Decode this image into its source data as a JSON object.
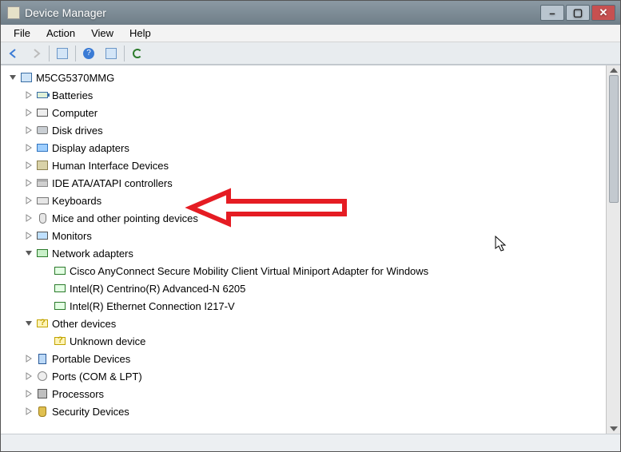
{
  "title": "Device Manager",
  "menu": {
    "file": "File",
    "action": "Action",
    "view": "View",
    "help": "Help"
  },
  "window_controls": {
    "min": "–",
    "max": "▢",
    "close": "✕"
  },
  "toolbar": {
    "back": "back",
    "fwd": "forward",
    "show": "show/hide console tree",
    "help": "?",
    "prop": "properties",
    "scan": "scan"
  },
  "tree": {
    "root": "M5CG5370MMG",
    "items": [
      {
        "label": "Batteries",
        "expanded": false,
        "icon": "battery"
      },
      {
        "label": "Computer",
        "expanded": false,
        "icon": "computer"
      },
      {
        "label": "Disk drives",
        "expanded": false,
        "icon": "drive"
      },
      {
        "label": "Display adapters",
        "expanded": false,
        "icon": "display"
      },
      {
        "label": "Human Interface Devices",
        "expanded": false,
        "icon": "usb"
      },
      {
        "label": "IDE ATA/ATAPI controllers",
        "expanded": false,
        "icon": "ide"
      },
      {
        "label": "Keyboards",
        "expanded": false,
        "icon": "keyboard"
      },
      {
        "label": "Mice and other pointing devices",
        "expanded": false,
        "icon": "mouse"
      },
      {
        "label": "Monitors",
        "expanded": false,
        "icon": "monitor"
      },
      {
        "label": "Network adapters",
        "expanded": true,
        "icon": "network",
        "children": [
          {
            "label": "Cisco AnyConnect Secure Mobility Client Virtual Miniport Adapter for Windows",
            "icon": "nic"
          },
          {
            "label": "Intel(R) Centrino(R) Advanced-N 6205",
            "icon": "nic"
          },
          {
            "label": "Intel(R) Ethernet Connection I217-V",
            "icon": "nic"
          }
        ]
      },
      {
        "label": "Other devices",
        "expanded": true,
        "icon": "unknown-cat",
        "children": [
          {
            "label": "Unknown device",
            "icon": "unknown"
          }
        ]
      },
      {
        "label": "Portable Devices",
        "expanded": false,
        "icon": "portable"
      },
      {
        "label": "Ports (COM & LPT)",
        "expanded": false,
        "icon": "ports"
      },
      {
        "label": "Processors",
        "expanded": false,
        "icon": "cpu"
      },
      {
        "label": "Security Devices",
        "expanded": false,
        "icon": "security"
      }
    ]
  }
}
